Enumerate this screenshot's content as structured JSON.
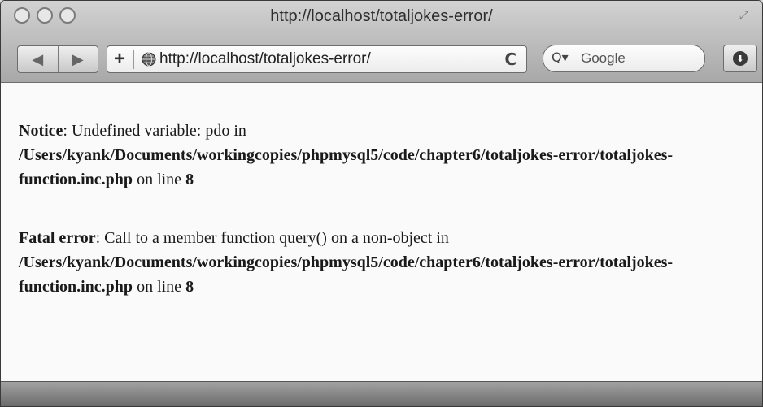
{
  "window": {
    "title": "http://localhost/totaljokes-error/"
  },
  "toolbar": {
    "back_label": "◀",
    "forward_label": "▶",
    "add_bookmark_label": "+",
    "address_value": "http://localhost/totaljokes-error/",
    "reload_label": "C",
    "search_prefix": "Q▾",
    "search_placeholder": "Google",
    "downloads_label": "⬇"
  },
  "content": {
    "errors": [
      {
        "label": "Notice",
        "message": ": Undefined variable: pdo in",
        "path": "/Users/kyank/Documents/workingcopies/phpmysql5/code/chapter6/totaljokes-error/totaljokes-function.inc.php",
        "on_line": " on line ",
        "line": "8"
      },
      {
        "label": "Fatal error",
        "message": ": Call to a member function query() on a non-object in",
        "path": "/Users/kyank/Documents/workingcopies/phpmysql5/code/chapter6/totaljokes-error/totaljokes-function.inc.php",
        "on_line": " on line ",
        "line": "8"
      }
    ]
  }
}
